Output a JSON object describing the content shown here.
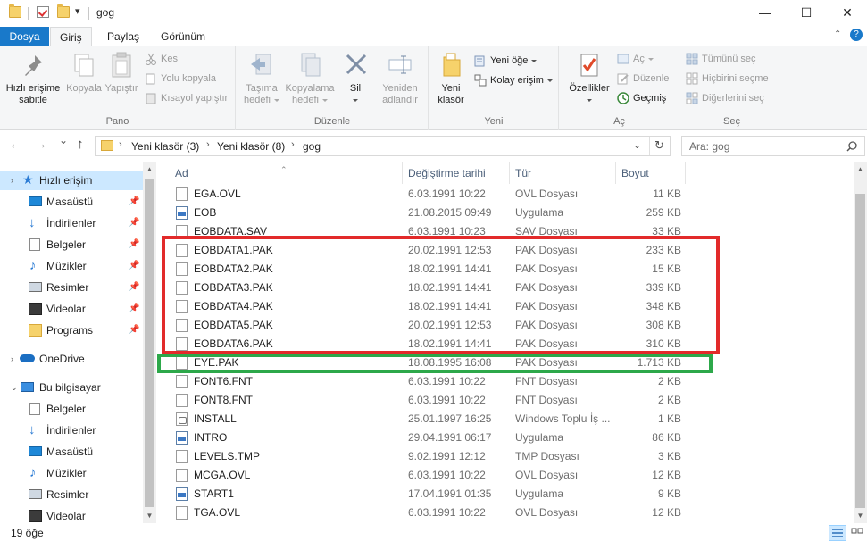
{
  "window": {
    "title": "gog",
    "quick_access_dropdown": "▾",
    "minimize": "—",
    "maximize": "☐",
    "close": "✕"
  },
  "tabs": {
    "file": "Dosya",
    "home": "Giriş",
    "share": "Paylaş",
    "view": "Görünüm"
  },
  "ribbon": {
    "pin_label_1": "Hızlı erişime",
    "pin_label_2": "sabitle",
    "copy": "Kopyala",
    "paste": "Yapıştır",
    "cut": "Kes",
    "copy_path": "Yolu kopyala",
    "paste_shortcut": "Kısayol yapıştır",
    "clipboard_group": "Pano",
    "move_to_1": "Taşıma",
    "move_to_2": "hedefi",
    "copy_to_1": "Kopyalama",
    "copy_to_2": "hedefi",
    "delete": "Sil",
    "rename_1": "Yeniden",
    "rename_2": "adlandır",
    "organize_group": "Düzenle",
    "new_folder_1": "Yeni",
    "new_folder_2": "klasör",
    "new_item": "Yeni öğe",
    "easy_access": "Kolay erişim",
    "new_group": "Yeni",
    "properties": "Özellikler",
    "open": "Aç",
    "edit": "Düzenle",
    "history": "Geçmiş",
    "open_group": "Aç",
    "select_all": "Tümünü seç",
    "select_none": "Hiçbirini seçme",
    "invert_selection": "Diğerlerini seç",
    "select_group": "Seç"
  },
  "navbar": {
    "back": "←",
    "forward": "→",
    "recent": "⌄",
    "up": "↑",
    "breadcrumbs": [
      "Yeni klasör (3)",
      "Yeni klasör (8)",
      "gog"
    ],
    "refresh": "↻",
    "search_placeholder": "Ara: gog"
  },
  "nav_pane": {
    "quick_access": "Hızlı erişim",
    "quick_items": [
      "Masaüstü",
      "İndirilenler",
      "Belgeler",
      "Müzikler",
      "Resimler",
      "Videolar",
      "Programs"
    ],
    "onedrive": "OneDrive",
    "this_pc": "Bu bilgisayar",
    "pc_items": [
      "Belgeler",
      "İndirilenler",
      "Masaüstü",
      "Müzikler",
      "Resimler",
      "Videolar"
    ]
  },
  "columns": {
    "name": "Ad",
    "modified": "Değiştirme tarihi",
    "type": "Tür",
    "size": "Boyut"
  },
  "files": [
    {
      "name": "EGA.OVL",
      "date": "6.03.1991 10:22",
      "type": "OVL Dosyası",
      "size": "11 KB",
      "icon": "file-icon"
    },
    {
      "name": "EOB",
      "date": "21.08.2015 09:49",
      "type": "Uygulama",
      "size": "259 KB",
      "icon": "app-icon"
    },
    {
      "name": "EOBDATA.SAV",
      "date": "6.03.1991 10:23",
      "type": "SAV Dosyası",
      "size": "33 KB",
      "icon": "file-icon"
    },
    {
      "name": "EOBDATA1.PAK",
      "date": "20.02.1991 12:53",
      "type": "PAK Dosyası",
      "size": "233 KB",
      "icon": "file-icon"
    },
    {
      "name": "EOBDATA2.PAK",
      "date": "18.02.1991 14:41",
      "type": "PAK Dosyası",
      "size": "15 KB",
      "icon": "file-icon"
    },
    {
      "name": "EOBDATA3.PAK",
      "date": "18.02.1991 14:41",
      "type": "PAK Dosyası",
      "size": "339 KB",
      "icon": "file-icon"
    },
    {
      "name": "EOBDATA4.PAK",
      "date": "18.02.1991 14:41",
      "type": "PAK Dosyası",
      "size": "348 KB",
      "icon": "file-icon"
    },
    {
      "name": "EOBDATA5.PAK",
      "date": "20.02.1991 12:53",
      "type": "PAK Dosyası",
      "size": "308 KB",
      "icon": "file-icon"
    },
    {
      "name": "EOBDATA6.PAK",
      "date": "18.02.1991 14:41",
      "type": "PAK Dosyası",
      "size": "310 KB",
      "icon": "file-icon"
    },
    {
      "name": "EYE.PAK",
      "date": "18.08.1995 16:08",
      "type": "PAK Dosyası",
      "size": "1.713 KB",
      "icon": "file-icon"
    },
    {
      "name": "FONT6.FNT",
      "date": "6.03.1991 10:22",
      "type": "FNT Dosyası",
      "size": "2 KB",
      "icon": "file-icon"
    },
    {
      "name": "FONT8.FNT",
      "date": "6.03.1991 10:22",
      "type": "FNT Dosyası",
      "size": "2 KB",
      "icon": "file-icon"
    },
    {
      "name": "INSTALL",
      "date": "25.01.1997 16:25",
      "type": "Windows Toplu İş ...",
      "size": "1 KB",
      "icon": "batch-icon"
    },
    {
      "name": "INTRO",
      "date": "29.04.1991 06:17",
      "type": "Uygulama",
      "size": "86 KB",
      "icon": "app-icon"
    },
    {
      "name": "LEVELS.TMP",
      "date": "9.02.1991 12:12",
      "type": "TMP Dosyası",
      "size": "3 KB",
      "icon": "file-icon"
    },
    {
      "name": "MCGA.OVL",
      "date": "6.03.1991 10:22",
      "type": "OVL Dosyası",
      "size": "12 KB",
      "icon": "file-icon"
    },
    {
      "name": "START1",
      "date": "17.04.1991 01:35",
      "type": "Uygulama",
      "size": "9 KB",
      "icon": "app-icon"
    },
    {
      "name": "TGA.OVL",
      "date": "6.03.1991 10:22",
      "type": "OVL Dosyası",
      "size": "12 KB",
      "icon": "file-icon"
    }
  ],
  "status": {
    "count": "19 öğe"
  },
  "colors": {
    "accent": "#1979ca",
    "highlight_red": "#e22a2a",
    "highlight_green": "#2da84a",
    "selection": "#cce8ff"
  }
}
